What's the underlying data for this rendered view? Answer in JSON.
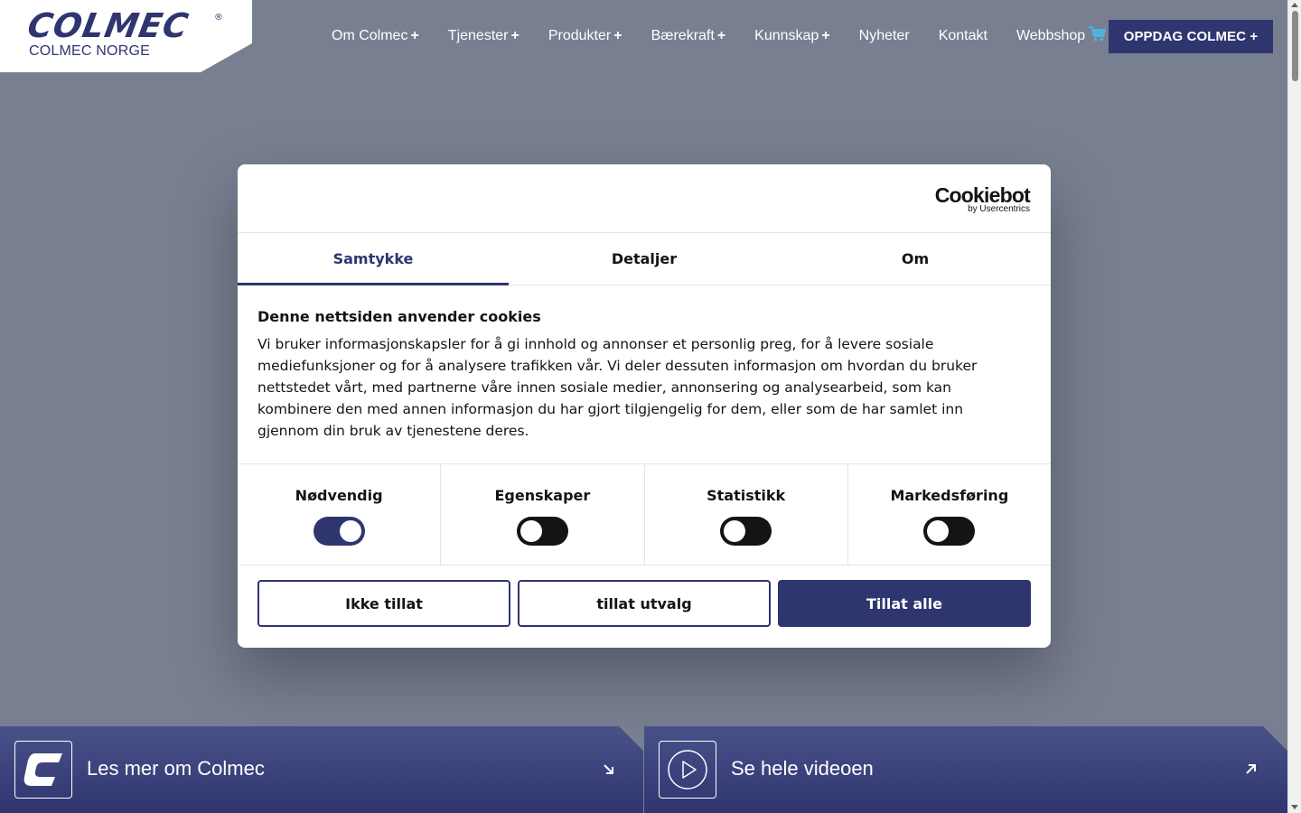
{
  "header": {
    "logo_text": "COLMEC",
    "logo_registered": "®",
    "logo_subtitle": "COLMEC NORGE",
    "nav": [
      {
        "label": "Om Colmec",
        "expandable": "+"
      },
      {
        "label": "Tjenester",
        "expandable": "+"
      },
      {
        "label": "Produkter",
        "expandable": "+"
      },
      {
        "label": "Bærekraft",
        "expandable": "+"
      },
      {
        "label": "Kunnskap",
        "expandable": "+"
      },
      {
        "label": "Nyheter"
      },
      {
        "label": "Kontakt"
      },
      {
        "label": "Webbshop",
        "icon": "cart-icon"
      }
    ],
    "cta_label": "OPPDAG COLMEC +"
  },
  "cookie_dialog": {
    "brand": "Cookiebot",
    "brand_sub": "by Usercentrics",
    "tabs": [
      {
        "label": "Samtykke",
        "active": true
      },
      {
        "label": "Detaljer",
        "active": false
      },
      {
        "label": "Om",
        "active": false
      }
    ],
    "title": "Denne nettsiden anvender cookies",
    "body": "Vi bruker informasjonskapsler for å gi innhold og annonser et personlig preg, for å levere sosiale mediefunksjoner og for å analysere trafikken vår. Vi deler dessuten informasjon om hvordan du bruker nettstedet vårt, med partnerne våre innen sosiale medier, annonsering og analysearbeid, som kan kombinere den med annen informasjon du har gjort tilgjengelig for dem, eller som de har samlet inn gjennom din bruk av tjenestene deres.",
    "toggles": [
      {
        "label": "Nødvendig",
        "on": true
      },
      {
        "label": "Egenskaper",
        "on": false
      },
      {
        "label": "Statistikk",
        "on": false
      },
      {
        "label": "Markedsføring",
        "on": false
      }
    ],
    "buttons": {
      "deny": "Ikke tillat",
      "allow_selection": "tillat utvalg",
      "allow_all": "Tillat alle"
    }
  },
  "bottom": {
    "left": {
      "label": "Les mer om Colmec",
      "icon": "colmec-c-icon",
      "arrow": "arrow-down-right-icon"
    },
    "right": {
      "label": "Se hele videoen",
      "icon": "play-icon",
      "arrow": "arrow-up-right-icon"
    }
  },
  "colors": {
    "brand": "#2f356f",
    "overlay_bg": "#787f91",
    "cart_icon": "#4fb3e0"
  }
}
